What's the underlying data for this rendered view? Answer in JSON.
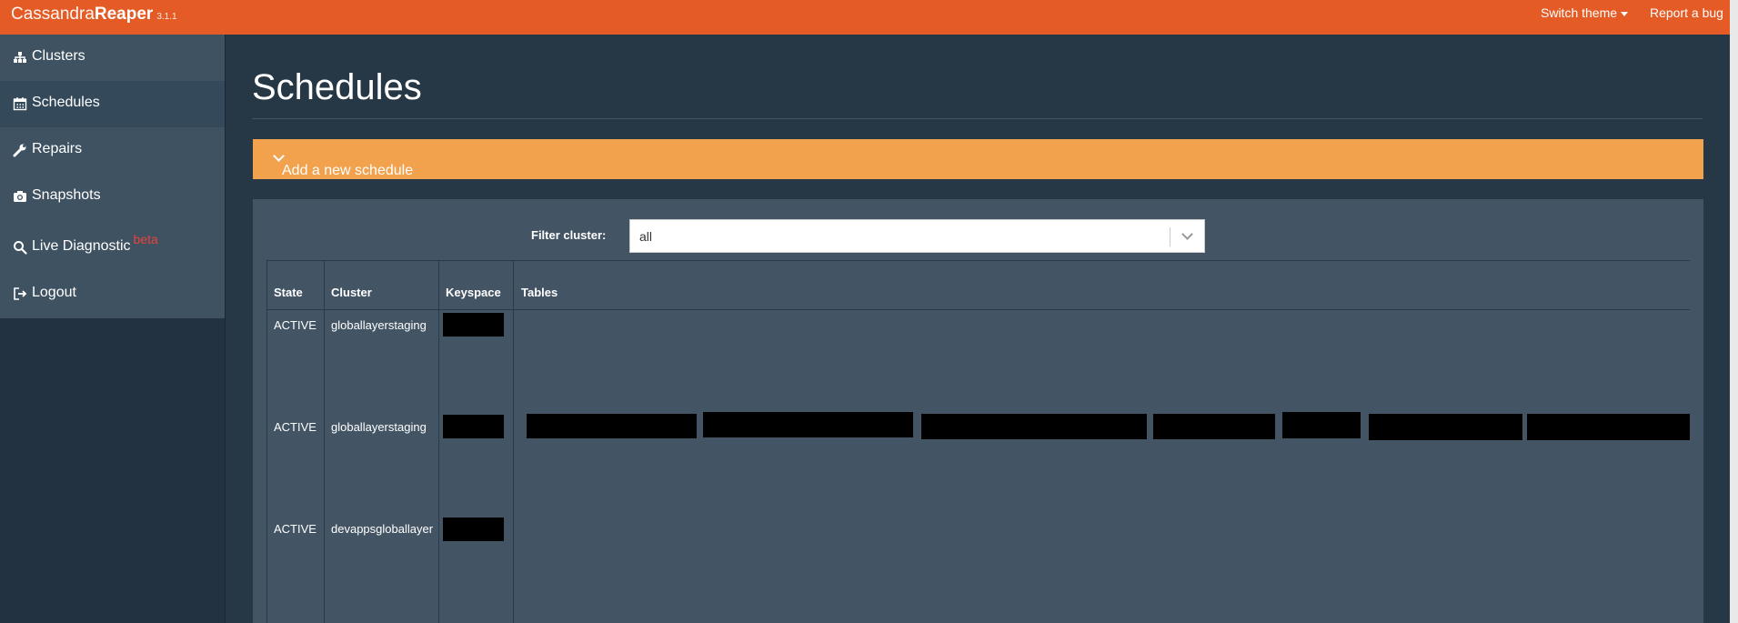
{
  "app": {
    "brand_light": "Cassandra",
    "brand_bold": "Reaper",
    "version": "3.1.1"
  },
  "topnav": {
    "switch_theme": "Switch theme",
    "report_bug": "Report a bug"
  },
  "sidebar": {
    "items": [
      {
        "label": "Clusters",
        "icon": "sitemap-icon"
      },
      {
        "label": "Schedules",
        "icon": "calendar-icon"
      },
      {
        "label": "Repairs",
        "icon": "wrench-icon"
      },
      {
        "label": "Snapshots",
        "icon": "camera-icon"
      },
      {
        "label": "Live Diagnostic",
        "icon": "search-icon",
        "badge": "beta"
      },
      {
        "label": "Logout",
        "icon": "sign-out-icon"
      }
    ],
    "active_index": 1
  },
  "page": {
    "title": "Schedules",
    "add_label": "Add a new schedule"
  },
  "filter": {
    "label": "Filter cluster:",
    "value": "all"
  },
  "table": {
    "headers": {
      "state": "State",
      "cluster": "Cluster",
      "keyspace": "Keyspace",
      "tables": "Tables"
    },
    "rows": [
      {
        "state": "ACTIVE",
        "cluster": "globallayerstaging"
      },
      {
        "state": "ACTIVE",
        "cluster": "globallayerstaging"
      },
      {
        "state": "ACTIVE",
        "cluster": "devappsgloballayer"
      }
    ]
  },
  "colors": {
    "topbar": "#e55b25",
    "add_bar": "#f2a14d",
    "background": "#263746",
    "panel": "#435464",
    "beta": "#e8423c"
  }
}
